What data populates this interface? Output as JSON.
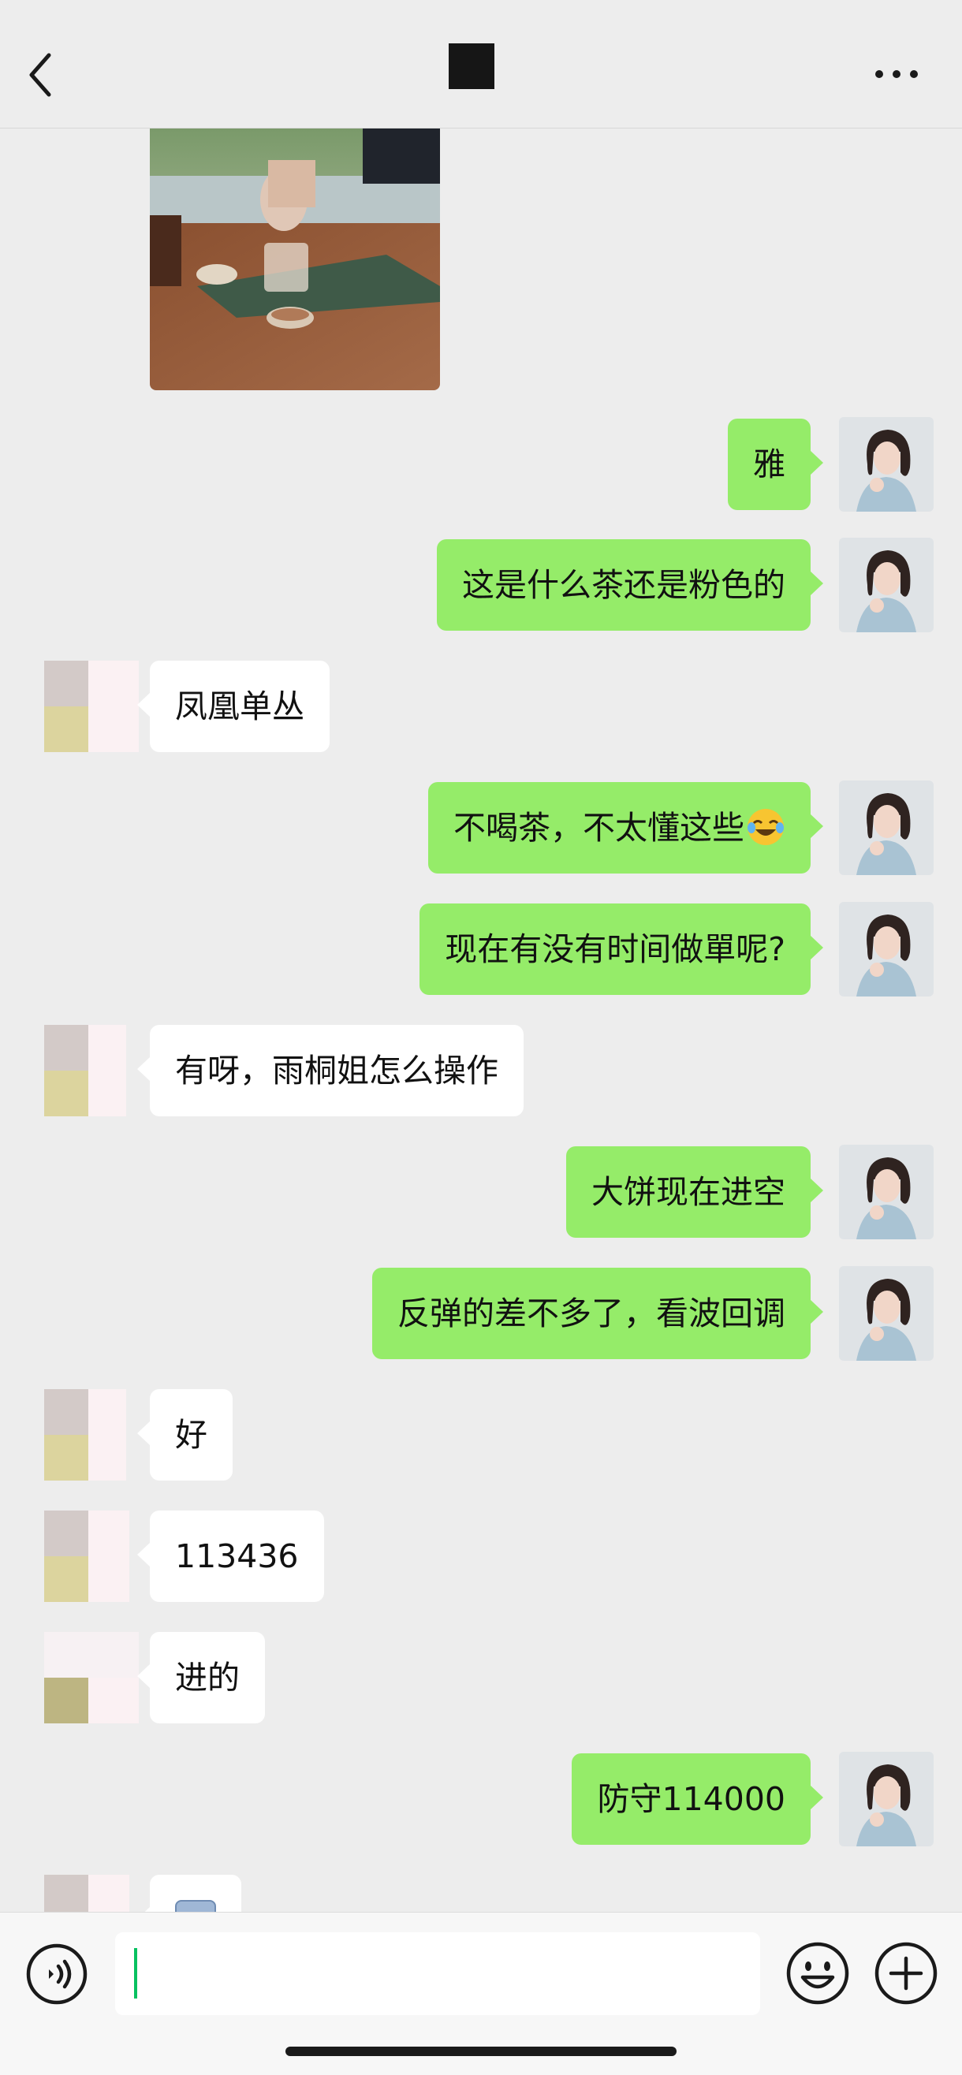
{
  "header": {
    "back_icon": "chevron-left-icon",
    "more_icon": "ellipsis-icon"
  },
  "messages": [
    {
      "side": "out",
      "text": "雅"
    },
    {
      "side": "out",
      "text": "这是什么茶还是粉色的"
    },
    {
      "side": "in",
      "text": "凤凰单丛"
    },
    {
      "side": "out",
      "text": "不喝茶，不太懂这些",
      "emoji": "laugh-cry-emoji"
    },
    {
      "side": "out",
      "text": "现在有没有时间做單呢?"
    },
    {
      "side": "in",
      "text": "有呀，雨桐姐怎么操作"
    },
    {
      "side": "out",
      "text": "大饼现在进空"
    },
    {
      "side": "out",
      "text": "反弹的差不多了，看波回调"
    },
    {
      "side": "in",
      "text": "好"
    },
    {
      "side": "in",
      "text": "113436"
    },
    {
      "side": "in",
      "text": "进的"
    },
    {
      "side": "out",
      "text": "防守114000"
    }
  ],
  "input_bar": {
    "voice_icon": "voice-icon",
    "emoji_icon": "smiley-icon",
    "plus_icon": "plus-icon",
    "input_value": ""
  },
  "colors": {
    "background": "#ededed",
    "outgoing_bubble": "#95ec69",
    "incoming_bubble": "#ffffff",
    "caret": "#07c160"
  }
}
